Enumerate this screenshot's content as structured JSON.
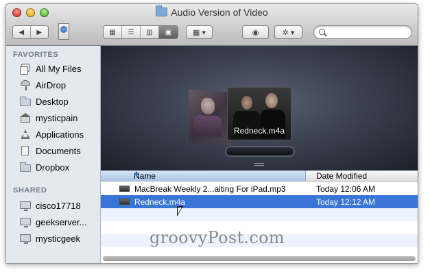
{
  "window": {
    "title": "Audio Version of Video"
  },
  "toolbar": {
    "back_icon": "back-arrow-icon",
    "forward_icon": "forward-arrow-icon",
    "quicklook_icon": "eye-icon",
    "action_icon": "gear-icon",
    "arrange_icon": "arrange-grid-icon",
    "view_modes": [
      "icon-view",
      "list-view",
      "column-view",
      "cover-flow-view"
    ],
    "active_view": "cover-flow-view",
    "search": {
      "value": "",
      "placeholder": ""
    }
  },
  "sidebar": {
    "favorites_label": "FAVORITES",
    "favorites": [
      {
        "label": "All My Files",
        "icon": "all-files-icon"
      },
      {
        "label": "AirDrop",
        "icon": "airdrop-icon"
      },
      {
        "label": "Desktop",
        "icon": "desktop-icon"
      },
      {
        "label": "mysticpain",
        "icon": "home-icon"
      },
      {
        "label": "Applications",
        "icon": "applications-icon"
      },
      {
        "label": "Documents",
        "icon": "documents-icon"
      },
      {
        "label": "Dropbox",
        "icon": "folder-icon"
      }
    ],
    "shared_label": "SHARED",
    "shared": [
      {
        "label": "cisco17718",
        "icon": "computer-icon"
      },
      {
        "label": "geekserver...",
        "icon": "computer-icon"
      },
      {
        "label": "mysticgeek",
        "icon": "computer-icon"
      }
    ]
  },
  "preview": {
    "selected_name": "Redneck.m4a"
  },
  "file_list": {
    "columns": [
      "Name",
      "Date Modified"
    ],
    "rows": [
      {
        "name": "MacBreak Weekly 2...aiting For iPad.mp3",
        "date": "Today 12:06 AM",
        "selected": false
      },
      {
        "name": "Redneck.m4a",
        "date": "Today 12:12 AM",
        "selected": true
      }
    ]
  },
  "watermark": "groovyPost.com",
  "colors": {
    "selection": "#3875d7",
    "sidebar_bg": "#e4e9ef",
    "stripe": "#edf3fe"
  }
}
